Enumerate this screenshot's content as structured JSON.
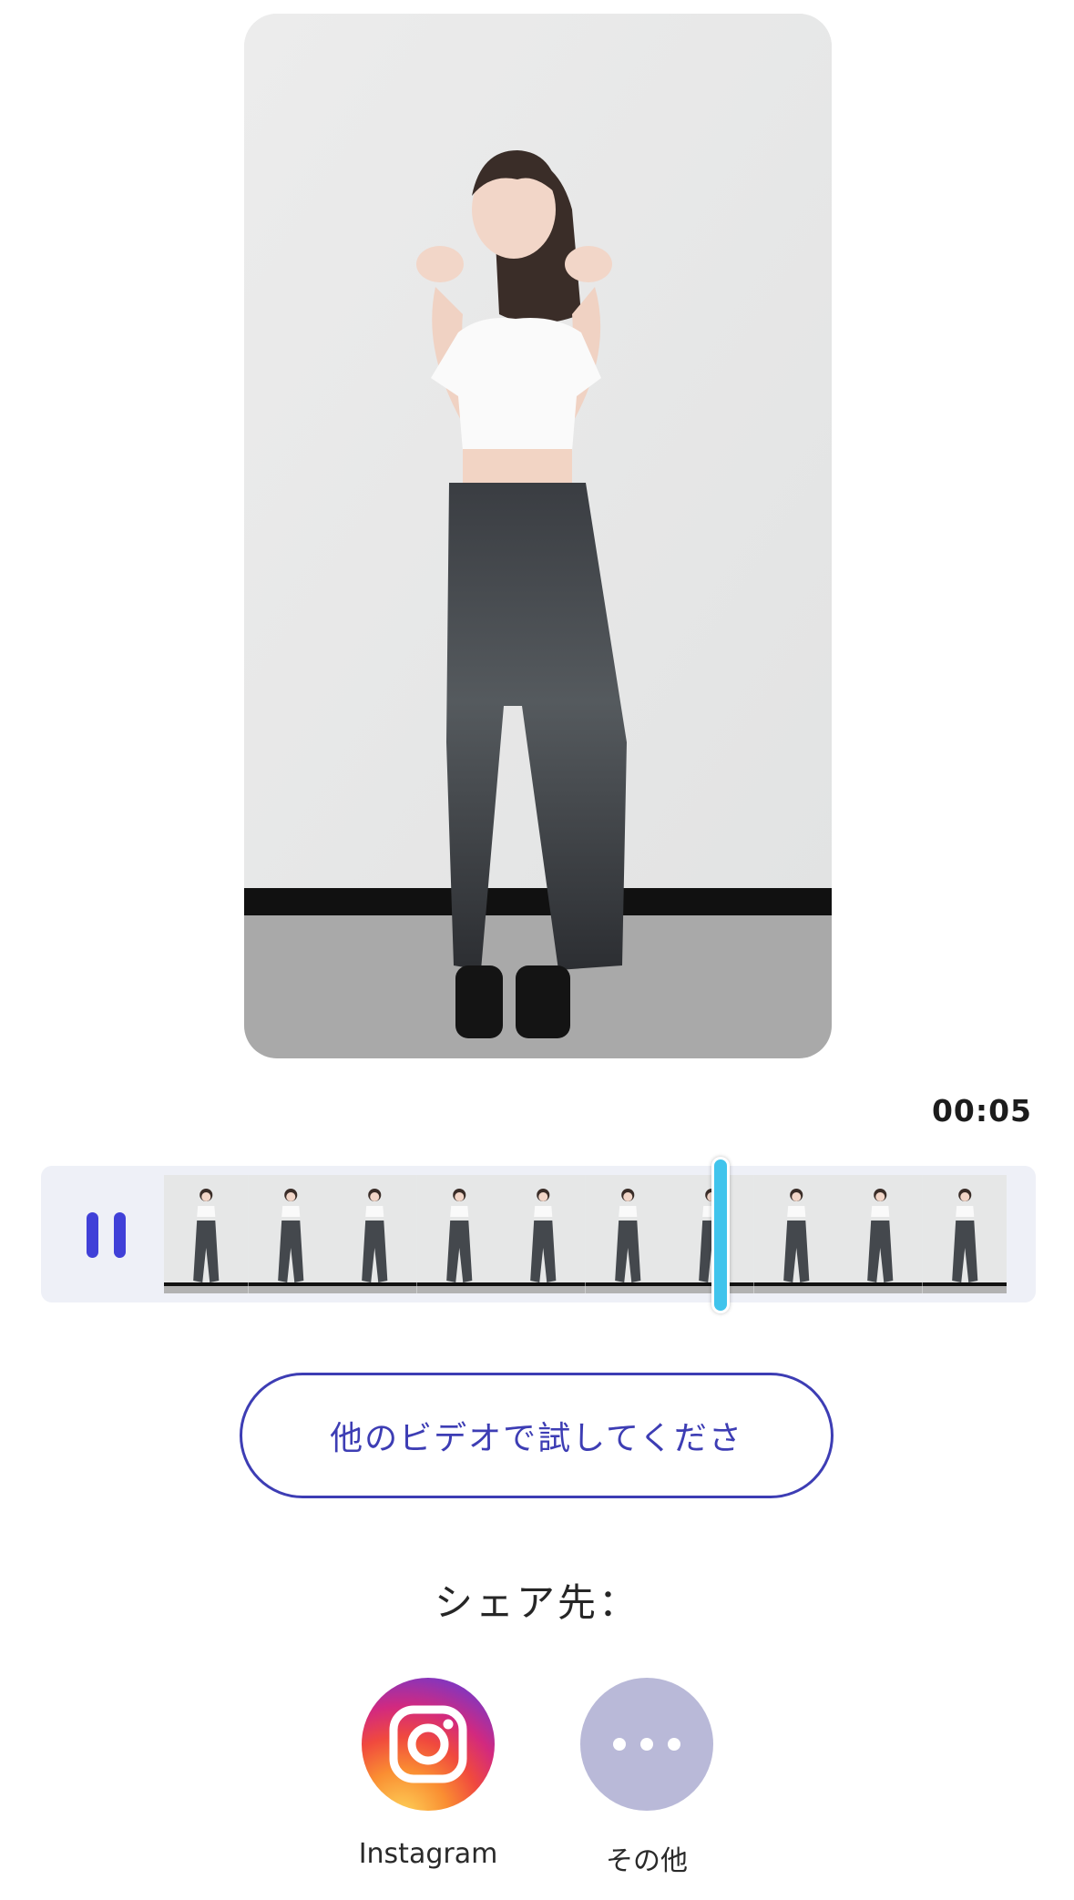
{
  "player": {
    "time": "00:05",
    "progress": 0.66,
    "frame_count": 10
  },
  "actions": {
    "try_other_video": "他のビデオで試してくださ"
  },
  "share": {
    "label": "シェア先：",
    "targets": [
      {
        "name": "Instagram",
        "icon": "instagram-icon"
      },
      {
        "name": "その他",
        "icon": "more-icon"
      }
    ]
  },
  "colors": {
    "accent": "#3d3db4",
    "pause_icon": "#4040d8",
    "playhead": "#40c4ec",
    "timeline_bg": "#eef0f7",
    "more_button": "#b9b9d8"
  }
}
